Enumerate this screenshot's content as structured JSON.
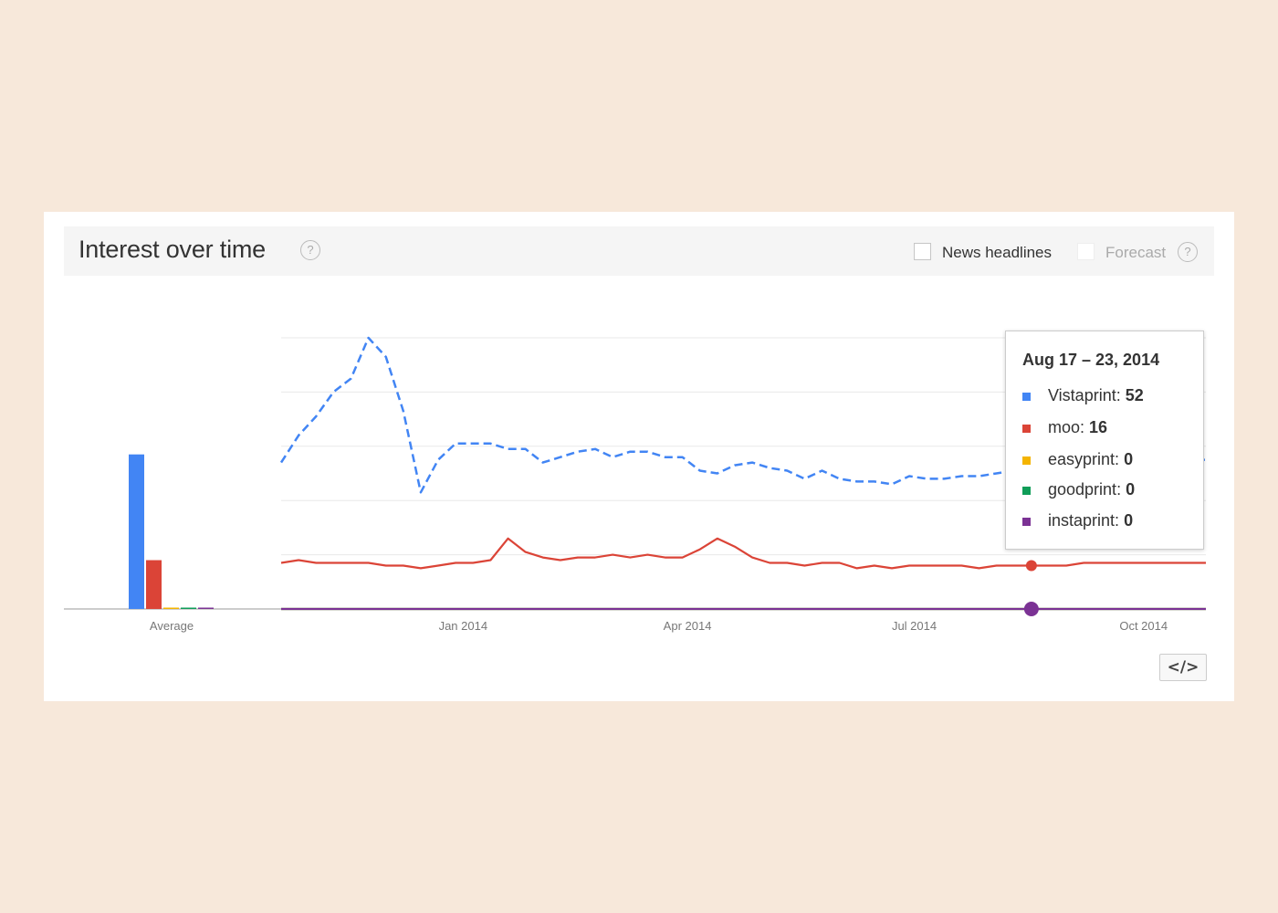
{
  "header": {
    "title": "Interest over time",
    "help_icon": "question-icon",
    "news_headlines_label": "News headlines",
    "forecast_label": "Forecast"
  },
  "tooltip": {
    "date": "Aug 17 – 23, 2014",
    "rows": [
      {
        "name": "Vistaprint",
        "value": "52",
        "color": "#4285f4"
      },
      {
        "name": "moo",
        "value": "16",
        "color": "#db4437"
      },
      {
        "name": "easyprint",
        "value": "0",
        "color": "#f4b400"
      },
      {
        "name": "goodprint",
        "value": "0",
        "color": "#0f9d58"
      },
      {
        "name": "instaprint",
        "value": "0",
        "color": "#7b3294"
      }
    ]
  },
  "embed_button": {
    "label": "</>",
    "icon": "embed-code-icon"
  },
  "chart_data": [
    {
      "type": "bar",
      "categories": [
        "Average"
      ],
      "series": [
        {
          "name": "Vistaprint",
          "color": "#4285f4",
          "values": [
            57
          ]
        },
        {
          "name": "moo",
          "color": "#db4437",
          "values": [
            18
          ]
        },
        {
          "name": "easyprint",
          "color": "#f4b400",
          "values": [
            0.5
          ]
        },
        {
          "name": "goodprint",
          "color": "#0f9d58",
          "values": [
            0.5
          ]
        },
        {
          "name": "instaprint",
          "color": "#7b3294",
          "values": [
            0.5
          ]
        }
      ],
      "ylim": [
        0,
        100
      ]
    },
    {
      "type": "line",
      "xlim": [
        "2013-10-20",
        "2014-10-26"
      ],
      "ylim": [
        0,
        100
      ],
      "grid": true,
      "tick_labels": [
        {
          "date": "2014-01-01",
          "label": "Jan 2014"
        },
        {
          "date": "2014-04-01",
          "label": "Apr 2014"
        },
        {
          "date": "2014-07-01",
          "label": "Jul 2014"
        },
        {
          "date": "2014-10-01",
          "label": "Oct 2014"
        }
      ],
      "highlight_x": "2014-08-17",
      "x": [
        "2013-10-20",
        "2013-10-27",
        "2013-11-03",
        "2013-11-10",
        "2013-11-17",
        "2013-11-24",
        "2013-12-01",
        "2013-12-08",
        "2013-12-15",
        "2013-12-22",
        "2013-12-29",
        "2014-01-05",
        "2014-01-12",
        "2014-01-19",
        "2014-01-26",
        "2014-02-02",
        "2014-02-09",
        "2014-02-16",
        "2014-02-23",
        "2014-03-02",
        "2014-03-09",
        "2014-03-16",
        "2014-03-23",
        "2014-03-30",
        "2014-04-06",
        "2014-04-13",
        "2014-04-20",
        "2014-04-27",
        "2014-05-04",
        "2014-05-11",
        "2014-05-18",
        "2014-05-25",
        "2014-06-01",
        "2014-06-08",
        "2014-06-15",
        "2014-06-22",
        "2014-06-29",
        "2014-07-06",
        "2014-07-13",
        "2014-07-20",
        "2014-07-27",
        "2014-08-03",
        "2014-08-10",
        "2014-08-17",
        "2014-08-24",
        "2014-08-31",
        "2014-09-07",
        "2014-09-14",
        "2014-09-21",
        "2014-09-28",
        "2014-10-05",
        "2014-10-12",
        "2014-10-19",
        "2014-10-26"
      ],
      "series": [
        {
          "name": "Vistaprint",
          "color": "#4285f4",
          "dashed": true,
          "values": [
            54,
            64,
            71,
            80,
            85,
            100,
            93,
            73,
            43,
            55,
            61,
            61,
            61,
            59,
            59,
            54,
            56,
            58,
            59,
            56,
            58,
            58,
            56,
            56,
            51,
            50,
            53,
            54,
            52,
            51,
            48,
            51,
            48,
            47,
            47,
            46,
            49,
            48,
            48,
            49,
            49,
            50,
            51,
            52,
            52,
            53,
            53,
            54,
            54,
            55,
            55,
            55,
            55,
            55
          ]
        },
        {
          "name": "moo",
          "color": "#db4437",
          "dashed": false,
          "values": [
            17,
            18,
            17,
            17,
            17,
            17,
            16,
            16,
            15,
            16,
            17,
            17,
            18,
            26,
            21,
            19,
            18,
            19,
            19,
            20,
            19,
            20,
            19,
            19,
            22,
            26,
            23,
            19,
            17,
            17,
            16,
            17,
            17,
            15,
            16,
            15,
            16,
            16,
            16,
            16,
            15,
            16,
            16,
            16,
            16,
            16,
            17,
            17,
            17,
            17,
            17,
            17,
            17,
            17
          ]
        },
        {
          "name": "easyprint",
          "color": "#f4b400",
          "dashed": false,
          "values": [
            0,
            0,
            0,
            0,
            0,
            0,
            0,
            0,
            0,
            0,
            0,
            0,
            0,
            0,
            0,
            0,
            0,
            0,
            0,
            0,
            0,
            0,
            0,
            0,
            0,
            0,
            0,
            0,
            0,
            0,
            0,
            0,
            0,
            0,
            0,
            0,
            0,
            0,
            0,
            0,
            0,
            0,
            0,
            0,
            0,
            0,
            0,
            0,
            0,
            0,
            0,
            0,
            0,
            0
          ]
        },
        {
          "name": "goodprint",
          "color": "#0f9d58",
          "dashed": false,
          "values": [
            0,
            0,
            0,
            0,
            0,
            0,
            0,
            0,
            0,
            0,
            0,
            0,
            0,
            0,
            0,
            0,
            0,
            0,
            0,
            0,
            0,
            0,
            0,
            0,
            0,
            0,
            0,
            0,
            0,
            0,
            0,
            0,
            0,
            0,
            0,
            0,
            0,
            0,
            0,
            0,
            0,
            0,
            0,
            0,
            0,
            0,
            0,
            0,
            0,
            0,
            0,
            0,
            0,
            0
          ]
        },
        {
          "name": "instaprint",
          "color": "#7b3294",
          "dashed": false,
          "values": [
            0,
            0,
            0,
            0,
            0,
            0,
            0,
            0,
            0,
            0,
            0,
            0,
            0,
            0,
            0,
            0,
            0,
            0,
            0,
            0,
            0,
            0,
            0,
            0,
            0,
            0,
            0,
            0,
            0,
            0,
            0,
            0,
            0,
            0,
            0,
            0,
            0,
            0,
            0,
            0,
            0,
            0,
            0,
            0,
            0,
            0,
            0,
            0,
            0,
            0,
            0,
            0,
            0,
            0
          ]
        }
      ]
    }
  ]
}
